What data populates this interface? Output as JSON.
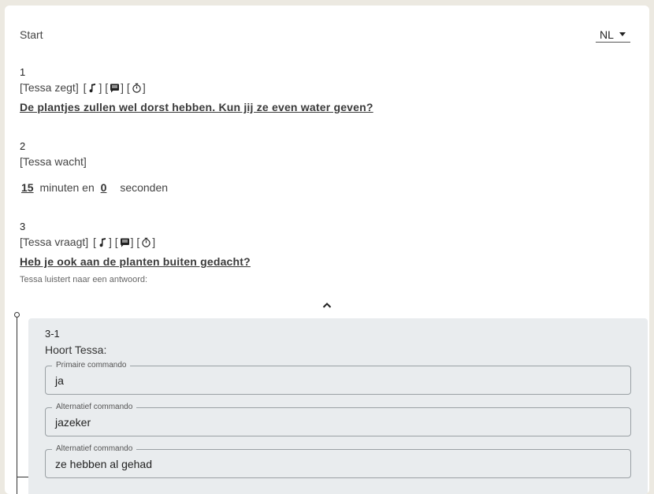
{
  "header": {
    "start_label": "Start",
    "language": "NL"
  },
  "steps": [
    {
      "number": "1",
      "speaker": "[Tessa zegt]",
      "text": "De plantjes zullen wel dorst hebben. Kun jij ze even water geven?"
    },
    {
      "number": "2",
      "speaker": "[Tessa wacht]",
      "minutes": "15",
      "minutes_label": "minuten en",
      "seconds": "0",
      "seconds_label": "seconden"
    },
    {
      "number": "3",
      "speaker": "[Tessa vraagt]",
      "text": "Heb je ook aan de planten buiten gedacht?",
      "hint": "Tessa luistert naar een antwoord:"
    }
  ],
  "icons": [
    "music-note-icon",
    "message-icon",
    "timer-icon",
    "chevron-up-icon"
  ],
  "answer": {
    "number": "3-1",
    "hears_label": "Hoort Tessa:",
    "fields": [
      {
        "label": "Primaire commando",
        "value": "ja"
      },
      {
        "label": "Alternatief commando",
        "value": "jazeker"
      },
      {
        "label": "Alternatief commando",
        "value": "ze hebben al gehad"
      }
    ]
  }
}
